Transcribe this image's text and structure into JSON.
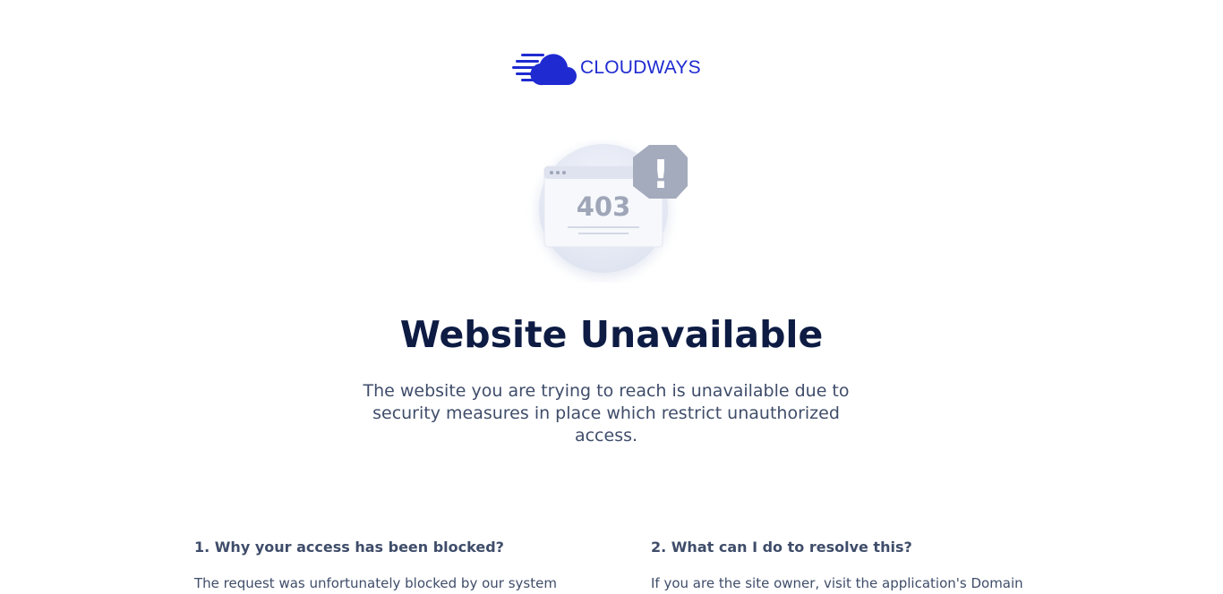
{
  "brand": {
    "name": "CLOUDWAYS",
    "logo_icon": "cloud-speed-icon",
    "color": "#1f2bd1"
  },
  "illustration": {
    "code": "403",
    "badge_symbol": "!",
    "icon": "browser-error-icon"
  },
  "title": "Website Unavailable",
  "subtitle": "The website you are trying to reach is unavailable due to security measures in place which restrict unauthorized access.",
  "sections": [
    {
      "heading": "1. Why your access has been blocked?",
      "body": "The request was unfortunately blocked by our system"
    },
    {
      "heading": "2. What can I do to resolve this?",
      "body": "If you are the site owner, visit the application's Domain"
    }
  ],
  "colors": {
    "title": "#0e1c44",
    "body_text": "#3f4d6a",
    "illustration_gray": "#9ea6b8"
  }
}
